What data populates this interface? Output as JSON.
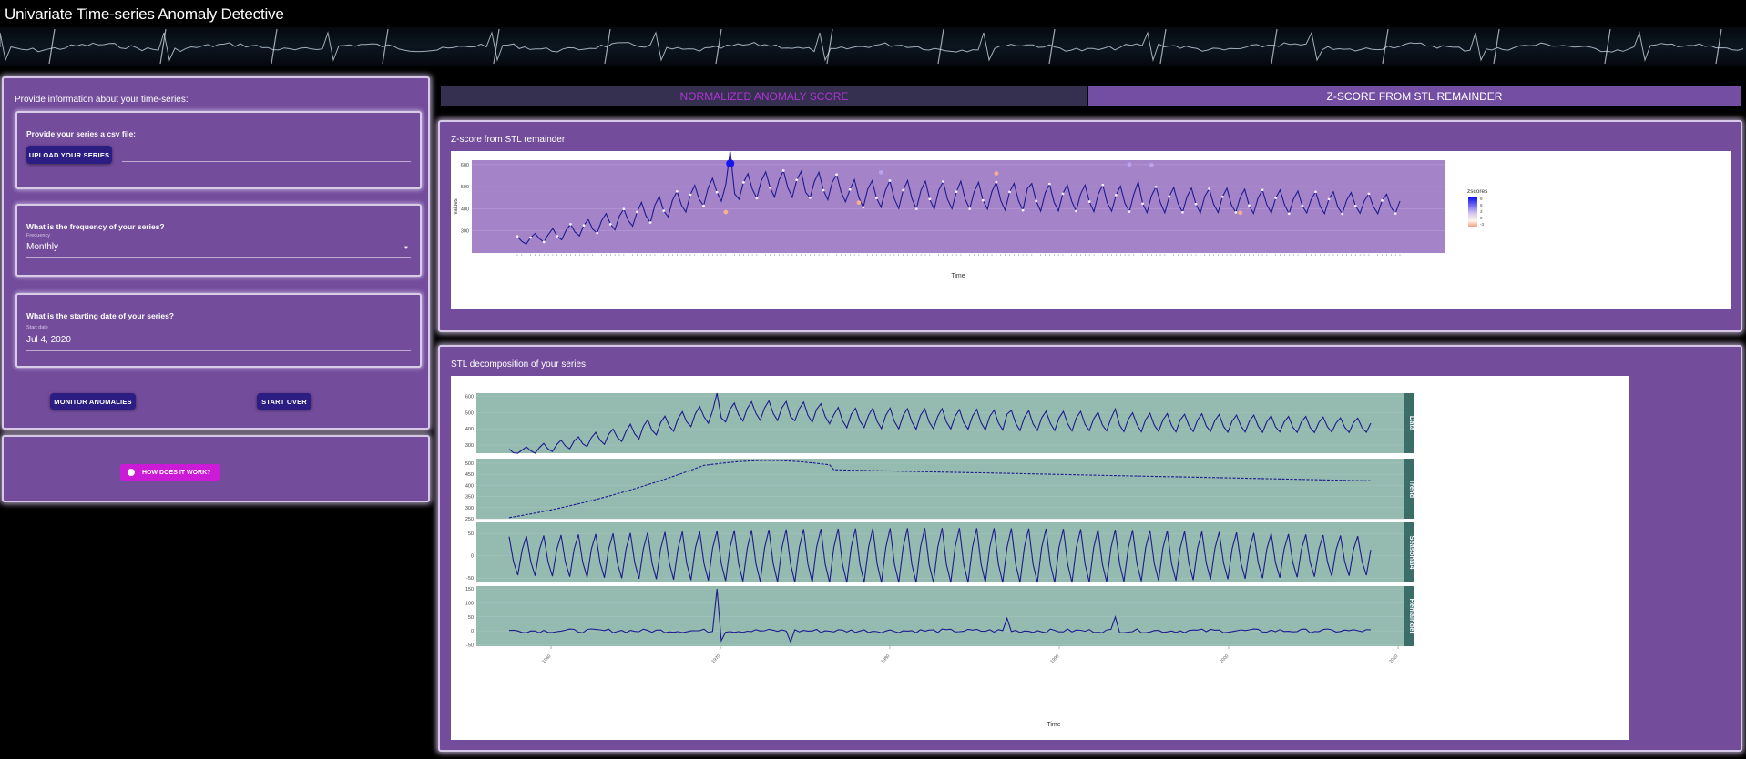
{
  "app": {
    "title": "Univariate Time-series Anomaly Detective"
  },
  "sidebar": {
    "heading": "Provide information about your time-series:",
    "upload": {
      "title": "Provide your series a csv file:",
      "button_label": "UPLOAD YOUR SERIES"
    },
    "frequency": {
      "title": "What is the frequency of your series?",
      "field_label": "Frequency",
      "value": "Monthly"
    },
    "start_date": {
      "title": "What is the starting date of your series?",
      "field_label": "Start date",
      "value": "Jul 4, 2020"
    },
    "monitor_label": "MONITOR ANOMALIES",
    "start_over_label": "START OVER",
    "help_label": "HOW DOES IT WORK?"
  },
  "tabs": [
    {
      "label": "NORMALIZED ANOMALY SCORE",
      "active": false
    },
    {
      "label": "Z-SCORE FROM STL REMAINDER",
      "active": true
    }
  ],
  "zscore_panel": {
    "title": "Z-score from STL remainder",
    "ylabel": "values",
    "xlabel": "Time",
    "legend_title": "zscores",
    "legend_ticks": [
      "9",
      "6",
      "3",
      "0",
      "-3"
    ]
  },
  "stl_panel": {
    "title": "STL decomposition of your series",
    "xlabel": "Time",
    "facets": [
      "Data",
      "Trend",
      "Seasonal4",
      "Remainder"
    ],
    "x_ticks": [
      "1960",
      "1970",
      "1980",
      "1990",
      "2000",
      "2010"
    ]
  },
  "colors": {
    "panel": "#734c9c",
    "button": "#2c1d82",
    "help_button": "#cc1bd6",
    "plot_bg_zscore": "#a583c9",
    "plot_bg_stl": "#95bab0",
    "strip": "#3b6e66",
    "line": "#1d1b8e"
  },
  "chart_data": [
    {
      "type": "line",
      "title": "Z-score from STL remainder",
      "xlabel": "Time",
      "ylabel": "values",
      "ylim": [
        200,
        620
      ],
      "y_ticks": [
        300,
        400,
        500,
        600
      ],
      "n_points": 200,
      "anomalies": [
        {
          "index": 48,
          "value": 605,
          "zscore": 9
        },
        {
          "index": 82,
          "value": 565,
          "zscore": 4
        },
        {
          "index": 138,
          "value": 600,
          "zscore": 3
        },
        {
          "index": 143,
          "value": 598,
          "zscore": 3
        },
        {
          "index": 47,
          "value": 385,
          "zscore": -3
        },
        {
          "index": 77,
          "value": 428,
          "zscore": -3
        },
        {
          "index": 108,
          "value": 560,
          "zscore": -2
        },
        {
          "index": 163,
          "value": 382,
          "zscore": -3
        }
      ],
      "color_scale": "zscores"
    },
    {
      "type": "line",
      "title": "STL decomposition of your series",
      "xlabel": "Time",
      "facets": [
        {
          "name": "Data",
          "ylim": [
            250,
            620
          ],
          "y_ticks": [
            300,
            400,
            500,
            600
          ]
        },
        {
          "name": "Trend",
          "ylim": [
            250,
            520
          ],
          "y_ticks": [
            250,
            300,
            350,
            400,
            450,
            500
          ]
        },
        {
          "name": "Seasonal4",
          "ylim": [
            -60,
            75
          ],
          "y_ticks": [
            -50,
            0,
            50
          ]
        },
        {
          "name": "Remainder",
          "ylim": [
            -55,
            160
          ],
          "y_ticks": [
            -50,
            0,
            50,
            100,
            150
          ]
        }
      ],
      "x_ticks": [
        1960,
        1970,
        1980,
        1990,
        2000,
        2010
      ],
      "n_points": 200,
      "trend_start": 255,
      "trend_end": 420,
      "spike_index": 48,
      "spike_value": 150
    }
  ]
}
